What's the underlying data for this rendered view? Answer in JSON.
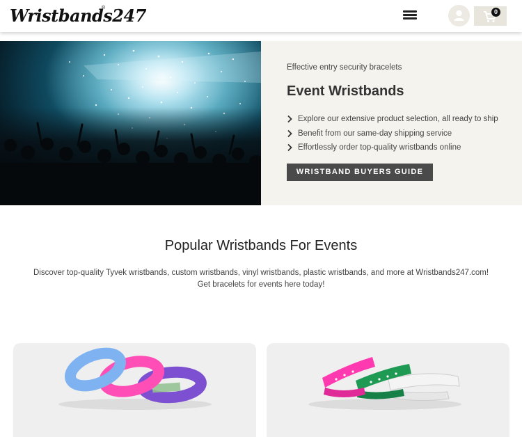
{
  "header": {
    "logo_text": "Wristbands247",
    "logo_reg": "®",
    "cart_count": "0",
    "icons": {
      "menu": "hamburger-menu-icon",
      "account": "user-icon",
      "cart": "shopping-cart-icon"
    }
  },
  "hero": {
    "image_alt": "Concert crowd with confetti",
    "kicker": "Effective entry security bracelets",
    "title": "Event Wristbands",
    "bullets": [
      "Explore our extensive product selection, all ready to ship",
      "Benefit from our same-day shipping service",
      "Effortlessly order top-quality wristbands online"
    ],
    "button_label": "WRISTBAND BUYERS GUIDE"
  },
  "popular": {
    "title": "Popular Wristbands For Events",
    "description_line1": "Discover top-quality Tyvek wristbands, custom wristbands, vinyl wristbands, plastic wristbands, and more at Wristbands247.com!",
    "description_line2": "Get bracelets for events here today!"
  },
  "colors": {
    "hero_panel_bg": "#f4f3ee",
    "button_bg": "#4a4a4a",
    "card_bg": "#efefef",
    "tyvek_blue": "#7fb2f0",
    "tyvek_pink": "#ff4fb6",
    "tyvek_purple": "#7d4fd1",
    "plastic_pink": "#ff3ab0",
    "plastic_green": "#1f9a55",
    "plastic_white": "#f4f4f4"
  }
}
